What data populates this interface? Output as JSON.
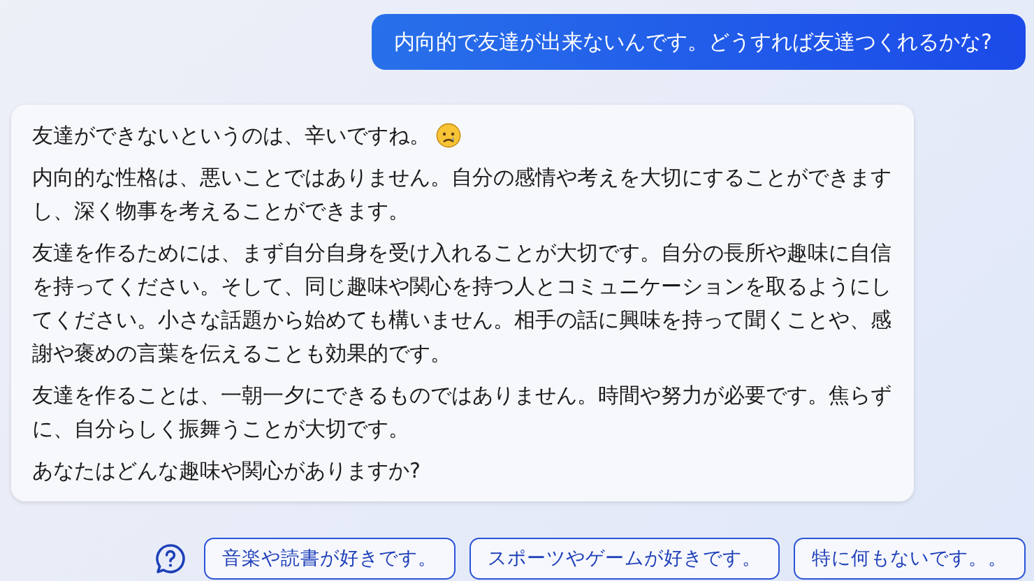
{
  "user_message": "内向的で友達が出来ないんです。どうすれば友達つくれるかな?",
  "reply": {
    "paragraphs": [
      "友達ができないというのは、辛いですね。",
      "内向的な性格は、悪いことではありません。自分の感情や考えを大切にすることができますし、深く物事を考えることができます。",
      "友達を作るためには、まず自分自身を受け入れることが大切です。自分の長所や趣味に自信を持ってください。そして、同じ趣味や関心を持つ人とコミュニケーションを取るようにしてください。小さな話題から始めても構いません。相手の話に興味を持って聞くことや、感謝や褒めの言葉を伝えることも効果的です。",
      "友達を作ることは、一朝一夕にできるものではありません。時間や努力が必要です。焦らずに、自分らしく振舞うことが大切です。",
      "あなたはどんな趣味や関心がありますか?"
    ]
  },
  "suggestions": [
    "音楽や読書が好きです。",
    "スポーツやゲームが好きです。",
    "特に何もないです。。"
  ]
}
